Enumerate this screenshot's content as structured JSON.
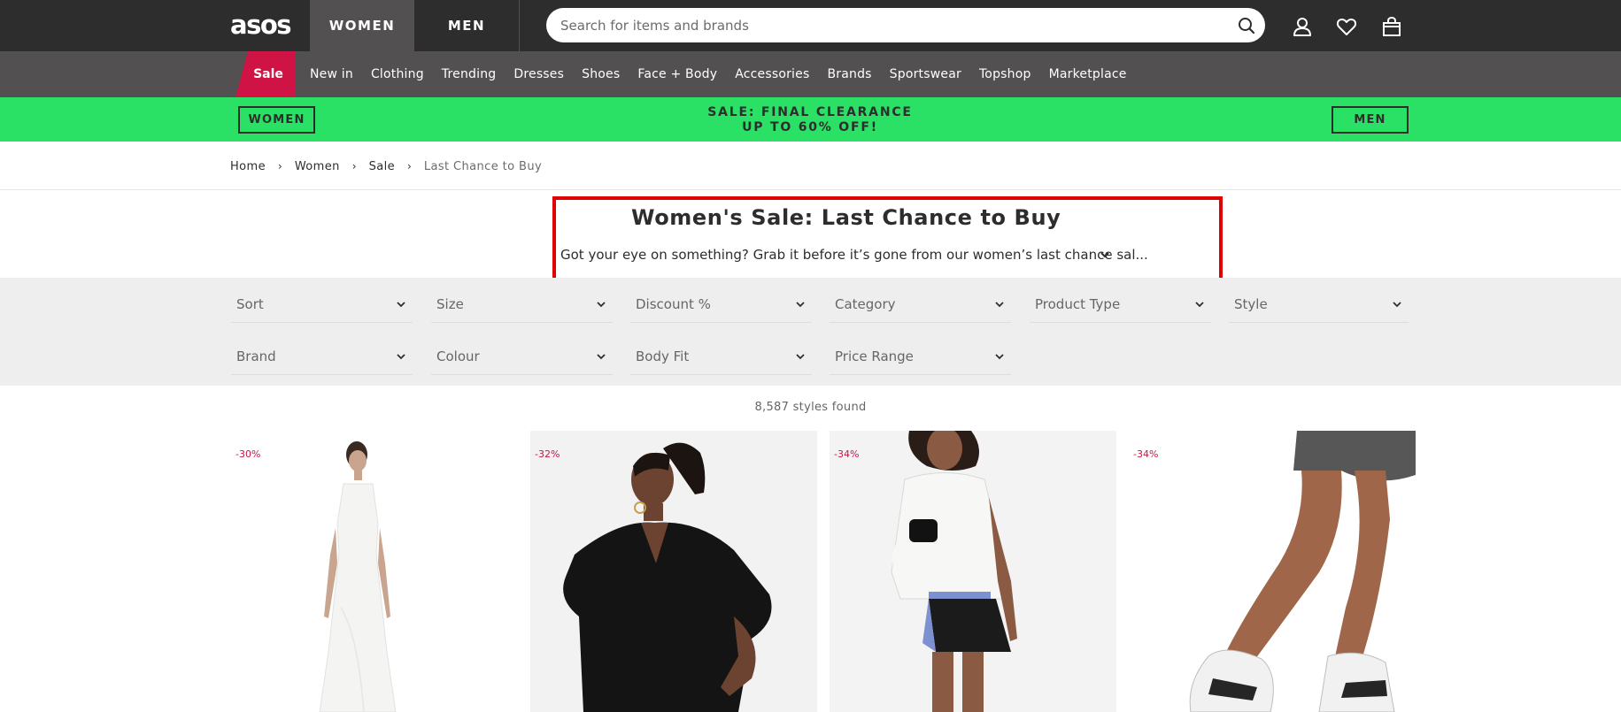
{
  "header": {
    "logo": "asos",
    "gender_tabs": [
      "WOMEN",
      "MEN"
    ],
    "search_placeholder": "Search for items and brands"
  },
  "nav": {
    "sale": "Sale",
    "items": [
      "New in",
      "Clothing",
      "Trending",
      "Dresses",
      "Shoes",
      "Face + Body",
      "Accessories",
      "Brands",
      "Sportswear",
      "Topshop",
      "Marketplace"
    ]
  },
  "promo": {
    "women_button": "WOMEN",
    "men_button": "MEN",
    "line1": "SALE: FINAL CLEARANCE",
    "line2": "UP TO 60% OFF!",
    "background": "#2ae065"
  },
  "breadcrumb": [
    "Home",
    "Women",
    "Sale",
    "Last Chance to Buy"
  ],
  "page": {
    "title": "Women's Sale: Last Chance to Buy",
    "description": "Got your eye on something? Grab it before it’s gone from our women’s last chance sal..."
  },
  "filters": {
    "row1": [
      "Sort",
      "Size",
      "Discount %",
      "Category",
      "Product Type",
      "Style"
    ],
    "row2": [
      "Brand",
      "Colour",
      "Body Fit",
      "Price Range"
    ]
  },
  "results_count": "8,587 styles found",
  "products": [
    {
      "discount": "-30%"
    },
    {
      "discount": "-32%"
    },
    {
      "discount": "-34%"
    },
    {
      "discount": "-34%"
    }
  ],
  "colors": {
    "top_bar": "#2d2d2d",
    "nav_bar": "#525050",
    "sale_red": "#d01345",
    "highlight_box": "#e00000"
  }
}
